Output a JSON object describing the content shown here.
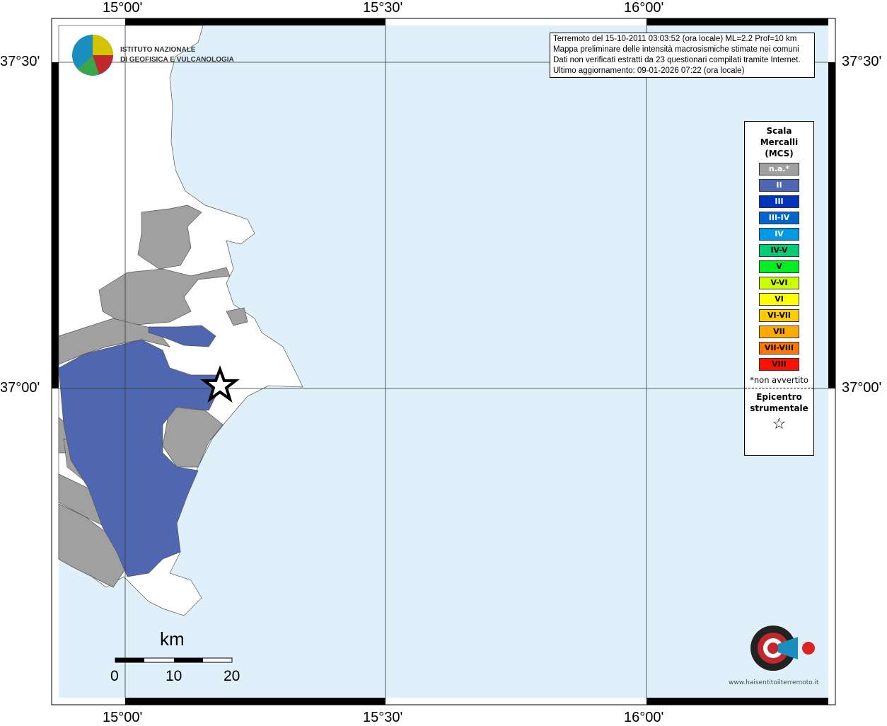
{
  "axes": {
    "top": [
      "15°00'",
      "15°30'",
      "16°00'"
    ],
    "bottom": [
      "15°00'",
      "15°30'",
      "16°00'"
    ],
    "left": [
      "37°30'",
      "37°00'"
    ],
    "right": [
      "37°30'",
      "37°00'"
    ]
  },
  "logo": {
    "line1": "ISTITUTO NAZIONALE",
    "line2": "DI GEOFISICA E VULCANOLOGIA"
  },
  "info": [
    "Terremoto del 15-10-2011 03:03:52 (ora locale) ML=2.2 Prof=10 km",
    "Mappa preliminare delle intensità macrosismiche stimate nei comuni",
    "Dati non verificati estratti da 23 questionari compilati tramite Internet.",
    "Ultimo aggiornamento: 09-01-2026 07:22 (ora locale)"
  ],
  "legend": {
    "title": [
      "Scala",
      "Mercalli",
      "(MCS)"
    ],
    "items": [
      {
        "label": "n.a.*",
        "color": "#a0a0a0",
        "text": "#fff"
      },
      {
        "label": "II",
        "color": "#4f67b1",
        "text": "#fff"
      },
      {
        "label": "III",
        "color": "#0033bb",
        "text": "#fff"
      },
      {
        "label": "III-IV",
        "color": "#0066cc",
        "text": "#fff"
      },
      {
        "label": "IV",
        "color": "#0099e6",
        "text": "#fff"
      },
      {
        "label": "IV-V",
        "color": "#00cc77",
        "text": "#000"
      },
      {
        "label": "V",
        "color": "#00ee22",
        "text": "#000"
      },
      {
        "label": "V-VI",
        "color": "#ccff00",
        "text": "#000"
      },
      {
        "label": "VI",
        "color": "#ffff00",
        "text": "#000"
      },
      {
        "label": "VI-VII",
        "color": "#ffcc00",
        "text": "#000"
      },
      {
        "label": "VII",
        "color": "#ffaa00",
        "text": "#000"
      },
      {
        "label": "VII-VIII",
        "color": "#ff7700",
        "text": "#000"
      },
      {
        "label": "VIII",
        "color": "#ff1100",
        "text": "#000"
      }
    ],
    "note": "*non avvertito",
    "epicentro": [
      "Epicentro",
      "strumentale"
    ]
  },
  "scale": {
    "unit": "km",
    "labels": [
      "0",
      "10",
      "20"
    ]
  },
  "watermark": "www.haisentitoilterremoto.it"
}
